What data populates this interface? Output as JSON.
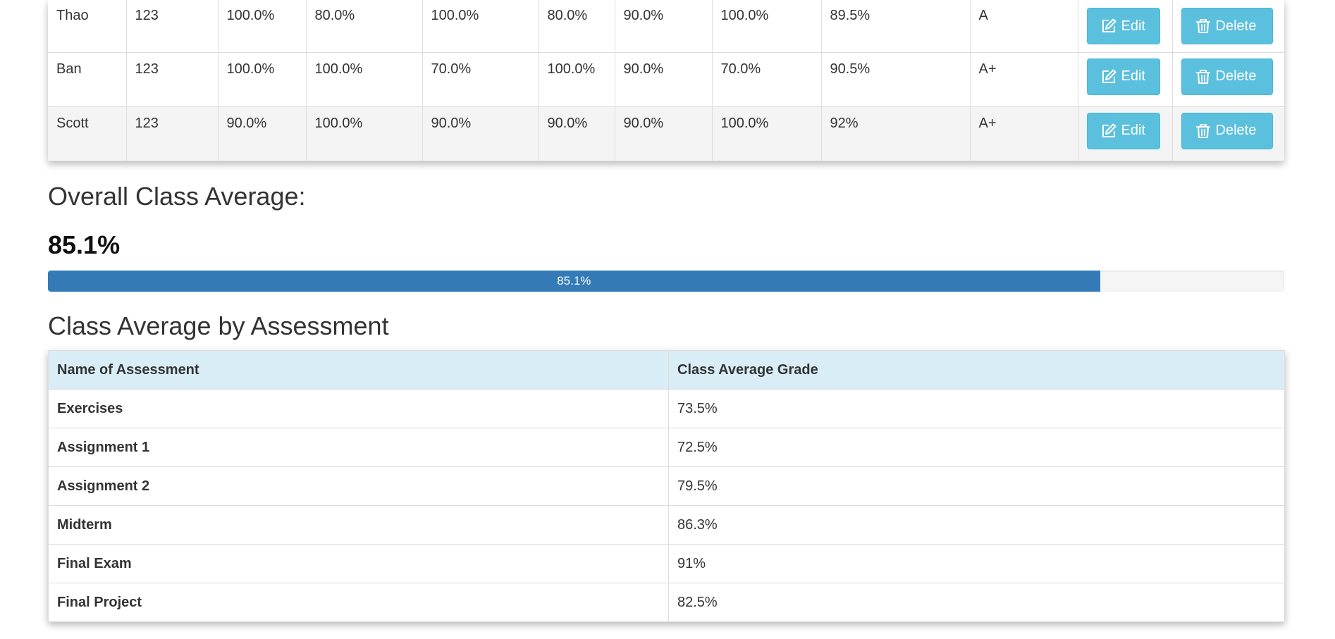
{
  "students": {
    "rows": [
      {
        "name": "Thao",
        "id": "123",
        "c1": "100.0%",
        "c2": "80.0%",
        "c3": "100.0%",
        "c4": "80.0%",
        "c5": "90.0%",
        "c6": "100.0%",
        "avg": "89.5%",
        "letter": "A",
        "edit_label": "Edit",
        "delete_label": "Delete"
      },
      {
        "name": "Ban",
        "id": "123",
        "c1": "100.0%",
        "c2": "100.0%",
        "c3": "70.0%",
        "c4": "100.0%",
        "c5": "90.0%",
        "c6": "70.0%",
        "avg": "90.5%",
        "letter": "A+",
        "edit_label": "Edit",
        "delete_label": "Delete"
      },
      {
        "name": "Scott",
        "id": "123",
        "c1": "90.0%",
        "c2": "100.0%",
        "c3": "90.0%",
        "c4": "90.0%",
        "c5": "90.0%",
        "c6": "100.0%",
        "avg": "92%",
        "letter": "A+",
        "edit_label": "Edit",
        "delete_label": "Delete"
      }
    ]
  },
  "overall": {
    "title": "Overall Class Average:",
    "value": "85.1%",
    "progress_label": "85.1%",
    "progress_fraction": 0.851
  },
  "assessment": {
    "title": "Class Average by Assessment",
    "headers": {
      "name": "Name of Assessment",
      "grade": "Class Average Grade"
    },
    "rows": [
      {
        "name": "Exercises",
        "grade": "73.5%"
      },
      {
        "name": "Assignment 1",
        "grade": "72.5%"
      },
      {
        "name": "Assignment 2",
        "grade": "79.5%"
      },
      {
        "name": "Midterm",
        "grade": "86.3%"
      },
      {
        "name": "Final Exam",
        "grade": "91%"
      },
      {
        "name": "Final Project",
        "grade": "82.5%"
      }
    ]
  },
  "colors": {
    "info_button": "#5bc0de",
    "progress": "#337ab7",
    "table_header": "#d9edf7",
    "stripe": "#f4f4f4"
  },
  "icons": {
    "edit": "edit-icon",
    "delete": "trash-icon"
  }
}
